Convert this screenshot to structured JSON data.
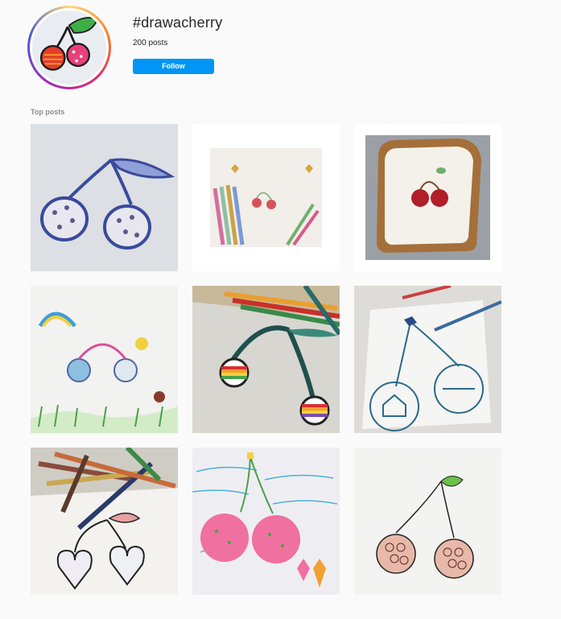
{
  "header": {
    "hashtag": "#drawacherry",
    "post_count": "200 posts",
    "follow_label": "Follow"
  },
  "section": {
    "top_posts_label": "Top posts"
  },
  "posts": [
    {
      "subject": "blue-ink cherry drawing"
    },
    {
      "subject": "cherry drawing with pencils and gold hearts"
    },
    {
      "subject": "cherry on toast"
    },
    {
      "subject": "child's drawing with rainbow and figures"
    },
    {
      "subject": "rainbow cherry drawing with colored pencils"
    },
    {
      "subject": "stay at home cherry drawing"
    },
    {
      "subject": "heart cherries with colored pencils"
    },
    {
      "subject": "pink cherry crayon drawing"
    },
    {
      "subject": "cherry blossom mandala cherry"
    }
  ],
  "colors": {
    "accent": "#0095f6",
    "background": "#fafafa"
  }
}
